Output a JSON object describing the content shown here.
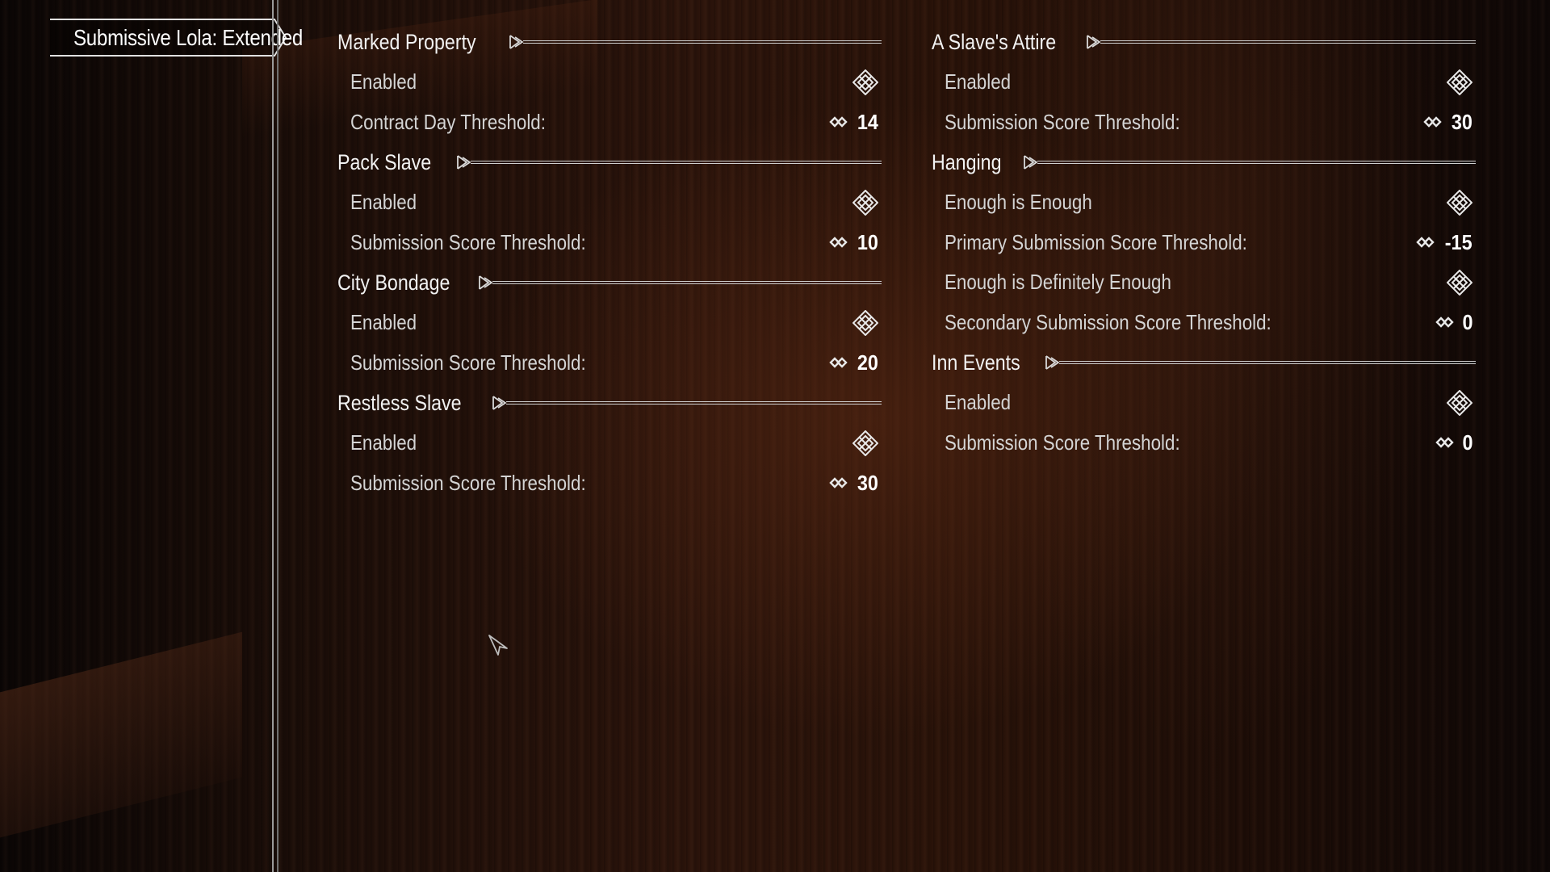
{
  "sidebar": {
    "active_tab": "Submissive Lola: Extended"
  },
  "colors": {
    "text": "#d4d4d4",
    "header": "#f2f2f2",
    "line": "#cfcfcf",
    "background": "#2a1309"
  },
  "left_column": [
    {
      "title": "Marked Property",
      "rows": [
        {
          "label": "Enabled",
          "type": "checkbox",
          "icon": "checkbox-icon"
        },
        {
          "label": "Contract Day Threshold:",
          "type": "slider",
          "value": "14"
        }
      ]
    },
    {
      "title": "Pack Slave",
      "rows": [
        {
          "label": "Enabled",
          "type": "checkbox",
          "icon": "checkbox-icon"
        },
        {
          "label": "Submission Score Threshold:",
          "type": "slider",
          "value": "10"
        }
      ]
    },
    {
      "title": "City Bondage",
      "rows": [
        {
          "label": "Enabled",
          "type": "checkbox",
          "icon": "checkbox-icon"
        },
        {
          "label": "Submission Score Threshold:",
          "type": "slider",
          "value": "20"
        }
      ]
    },
    {
      "title": "Restless Slave",
      "rows": [
        {
          "label": "Enabled",
          "type": "checkbox",
          "icon": "checkbox-icon"
        },
        {
          "label": "Submission Score Threshold:",
          "type": "slider",
          "value": "30"
        }
      ]
    }
  ],
  "right_column": [
    {
      "title": "A Slave's Attire",
      "rows": [
        {
          "label": "Enabled",
          "type": "checkbox",
          "icon": "checkbox-icon"
        },
        {
          "label": "Submission Score Threshold:",
          "type": "slider",
          "value": "30"
        }
      ]
    },
    {
      "title": "Hanging",
      "rows": [
        {
          "label": "Enough is Enough",
          "type": "checkbox",
          "icon": "checkbox-icon"
        },
        {
          "label": "Primary Submission Score Threshold:",
          "type": "slider",
          "value": "-15"
        },
        {
          "label": "Enough is Definitely Enough",
          "type": "checkbox",
          "icon": "checkbox-icon"
        },
        {
          "label": "Secondary Submission Score Threshold:",
          "type": "slider",
          "value": "0"
        }
      ]
    },
    {
      "title": "Inn Events",
      "rows": [
        {
          "label": "Enabled",
          "type": "checkbox",
          "icon": "checkbox-icon"
        },
        {
          "label": "Submission Score Threshold:",
          "type": "slider",
          "value": "0"
        }
      ]
    }
  ]
}
